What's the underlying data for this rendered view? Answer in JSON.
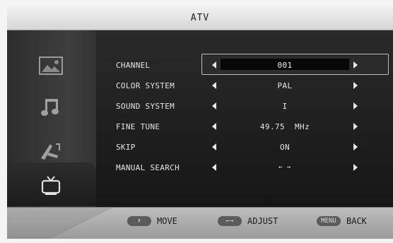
{
  "header": {
    "title": "ATV"
  },
  "sidebar": {
    "items": [
      {
        "icon": "picture-icon"
      },
      {
        "icon": "music-note-icon"
      },
      {
        "icon": "setup-tools-icon"
      },
      {
        "icon": "tv-icon",
        "active": true
      }
    ]
  },
  "menu": {
    "rows": [
      {
        "label": "CHANNEL",
        "value": "001",
        "selected": true
      },
      {
        "label": "COLOR SYSTEM",
        "value": "PAL"
      },
      {
        "label": "SOUND SYSTEM",
        "value": "I"
      },
      {
        "label": "FINE TUNE",
        "value": "49.75  MHz"
      },
      {
        "label": "SKIP",
        "value": "ON"
      },
      {
        "label": "MANUAL SEARCH",
        "value": "← →"
      }
    ]
  },
  "footer": {
    "move": {
      "key": "⬍",
      "label": "MOVE"
    },
    "adjust": {
      "key": "←→",
      "label": "ADJUST"
    },
    "back": {
      "key": "MENU",
      "label": "BACK"
    }
  }
}
